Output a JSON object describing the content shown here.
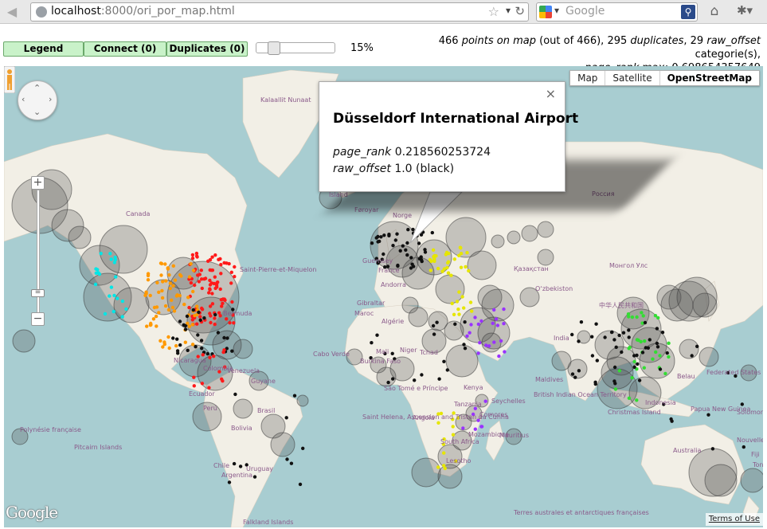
{
  "browser": {
    "url_host": "localhost",
    "url_rest": ":8000/ori_por_map.html",
    "search_placeholder": "Google"
  },
  "toolbar": {
    "legend_label": "Legend",
    "connect_label": "Connect (0)",
    "duplicates_label": "Duplicates (0)",
    "slider_value": "15%",
    "slider_fraction": 0.15
  },
  "stats": {
    "points_count": "466",
    "points_phrase": "points on map",
    "out_of": "(out of 466),",
    "duplicates_count": "295",
    "duplicates_word": "duplicates",
    "comma_29": ",",
    "raw_offset_count": "29",
    "raw_offset_word": "raw_offset",
    "categories_word": "categorie(s),",
    "page_rank_word": "page_rank",
    "max_label": "max: 0.698654357649"
  },
  "map": {
    "map_types": [
      "Map",
      "Satellite",
      "OpenStreetMap"
    ],
    "active_map_type": "OpenStreetMap",
    "google_logo": "Google",
    "terms_label": "Terms of Use",
    "labels": [
      {
        "text": "Kalaallit Nunaat",
        "kind": "country"
      },
      {
        "text": "Canada",
        "kind": "country"
      },
      {
        "text": "Ísland",
        "kind": "country"
      },
      {
        "text": "Føroyar",
        "kind": "country"
      },
      {
        "text": "Norge",
        "kind": "country"
      },
      {
        "text": "Россия",
        "kind": "country"
      },
      {
        "text": "Saint-Pierre-et-Miquelon",
        "kind": "country"
      },
      {
        "text": "Bermuda",
        "kind": "country"
      },
      {
        "text": "Қазақстан",
        "kind": "country"
      },
      {
        "text": "Oʻzbekiston",
        "kind": "country"
      },
      {
        "text": "Монгол Улс",
        "kind": "country"
      },
      {
        "text": "中华人民共和国",
        "kind": "country"
      },
      {
        "text": "Algérie",
        "kind": "country"
      },
      {
        "text": "Maroc",
        "kind": "country"
      },
      {
        "text": "Gibraltar",
        "kind": "country"
      },
      {
        "text": "Mali",
        "kind": "country"
      },
      {
        "text": "Niger",
        "kind": "country"
      },
      {
        "text": "Tchad",
        "kind": "country"
      },
      {
        "text": "Cabo Verde",
        "kind": "country"
      },
      {
        "text": "Burkina Faso",
        "kind": "country"
      },
      {
        "text": "São Tomé e Príncipe",
        "kind": "country"
      },
      {
        "text": "Angola",
        "kind": "country"
      },
      {
        "text": "Kenya",
        "kind": "country"
      },
      {
        "text": "Tanzania",
        "kind": "country"
      },
      {
        "text": "Seychelles",
        "kind": "country"
      },
      {
        "text": "Mauritius",
        "kind": "country"
      },
      {
        "text": "Mozambique",
        "kind": "country"
      },
      {
        "text": "Lesotho",
        "kind": "country"
      },
      {
        "text": "British Indian Ocean Territory",
        "kind": "country"
      },
      {
        "text": "Maldives",
        "kind": "country"
      },
      {
        "text": "India",
        "kind": "country"
      },
      {
        "text": "Indonesia",
        "kind": "country"
      },
      {
        "text": "Christmas Island",
        "kind": "country"
      },
      {
        "text": "Australia",
        "kind": "country"
      },
      {
        "text": "Papua New Guinea",
        "kind": "country"
      },
      {
        "text": "Federated States of Micronesia",
        "kind": "country"
      },
      {
        "text": "Solomon Islands",
        "kind": "country"
      },
      {
        "text": "Nouvelle-Calédonie",
        "kind": "country"
      },
      {
        "text": "Fiji",
        "kind": "country"
      },
      {
        "text": "Tonga",
        "kind": "country"
      },
      {
        "text": "Belau",
        "kind": "country"
      },
      {
        "text": "Pitcairn Islands",
        "kind": "country"
      },
      {
        "text": "Polynésie française",
        "kind": "country"
      },
      {
        "text": "Ecuador",
        "kind": "country"
      },
      {
        "text": "Perú",
        "kind": "country"
      },
      {
        "text": "Bolivia",
        "kind": "country"
      },
      {
        "text": "Brasil",
        "kind": "country"
      },
      {
        "text": "Chile",
        "kind": "country"
      },
      {
        "text": "Argentina",
        "kind": "country"
      },
      {
        "text": "Uruguay",
        "kind": "country"
      },
      {
        "text": "Colombia",
        "kind": "country"
      },
      {
        "text": "Venezuela",
        "kind": "country"
      },
      {
        "text": "Guyane",
        "kind": "country"
      },
      {
        "text": "Nicaragua",
        "kind": "country"
      },
      {
        "text": "Saint Helena, Ascension and Tristan da Cunha",
        "kind": "country"
      },
      {
        "text": "Falkland Islands",
        "kind": "country"
      },
      {
        "text": "Terres australes et antarctiques françaises",
        "kind": "country"
      },
      {
        "text": "South Africa",
        "kind": "country"
      },
      {
        "text": "Comores",
        "kind": "country"
      },
      {
        "text": "France",
        "kind": "country"
      },
      {
        "text": "Andorra",
        "kind": "country"
      },
      {
        "text": "Guernsey",
        "kind": "country"
      }
    ]
  },
  "infowindow": {
    "title": "Düsseldorf International Airport",
    "page_rank_label": "page_rank",
    "page_rank_value": "0.218560253724",
    "raw_offset_label": "raw_offset",
    "raw_offset_value": "1.0 (black)",
    "close_symbol": "×"
  },
  "colors": {
    "water": "#a8cdd1",
    "land": "#f2efe6",
    "button_bg": "#c9f2c9",
    "cat_cyan": "#00e6e6",
    "cat_orange": "#ff9900",
    "cat_red": "#ff1a1a",
    "cat_yellow": "#e6e600",
    "cat_purple": "#9933ff",
    "cat_green": "#33dd33",
    "cat_black": "#111111"
  },
  "icons": {
    "back": "back-arrow-icon",
    "star": "star-icon",
    "reload": "reload-icon",
    "home": "home-icon",
    "search": "magnifier-icon"
  }
}
